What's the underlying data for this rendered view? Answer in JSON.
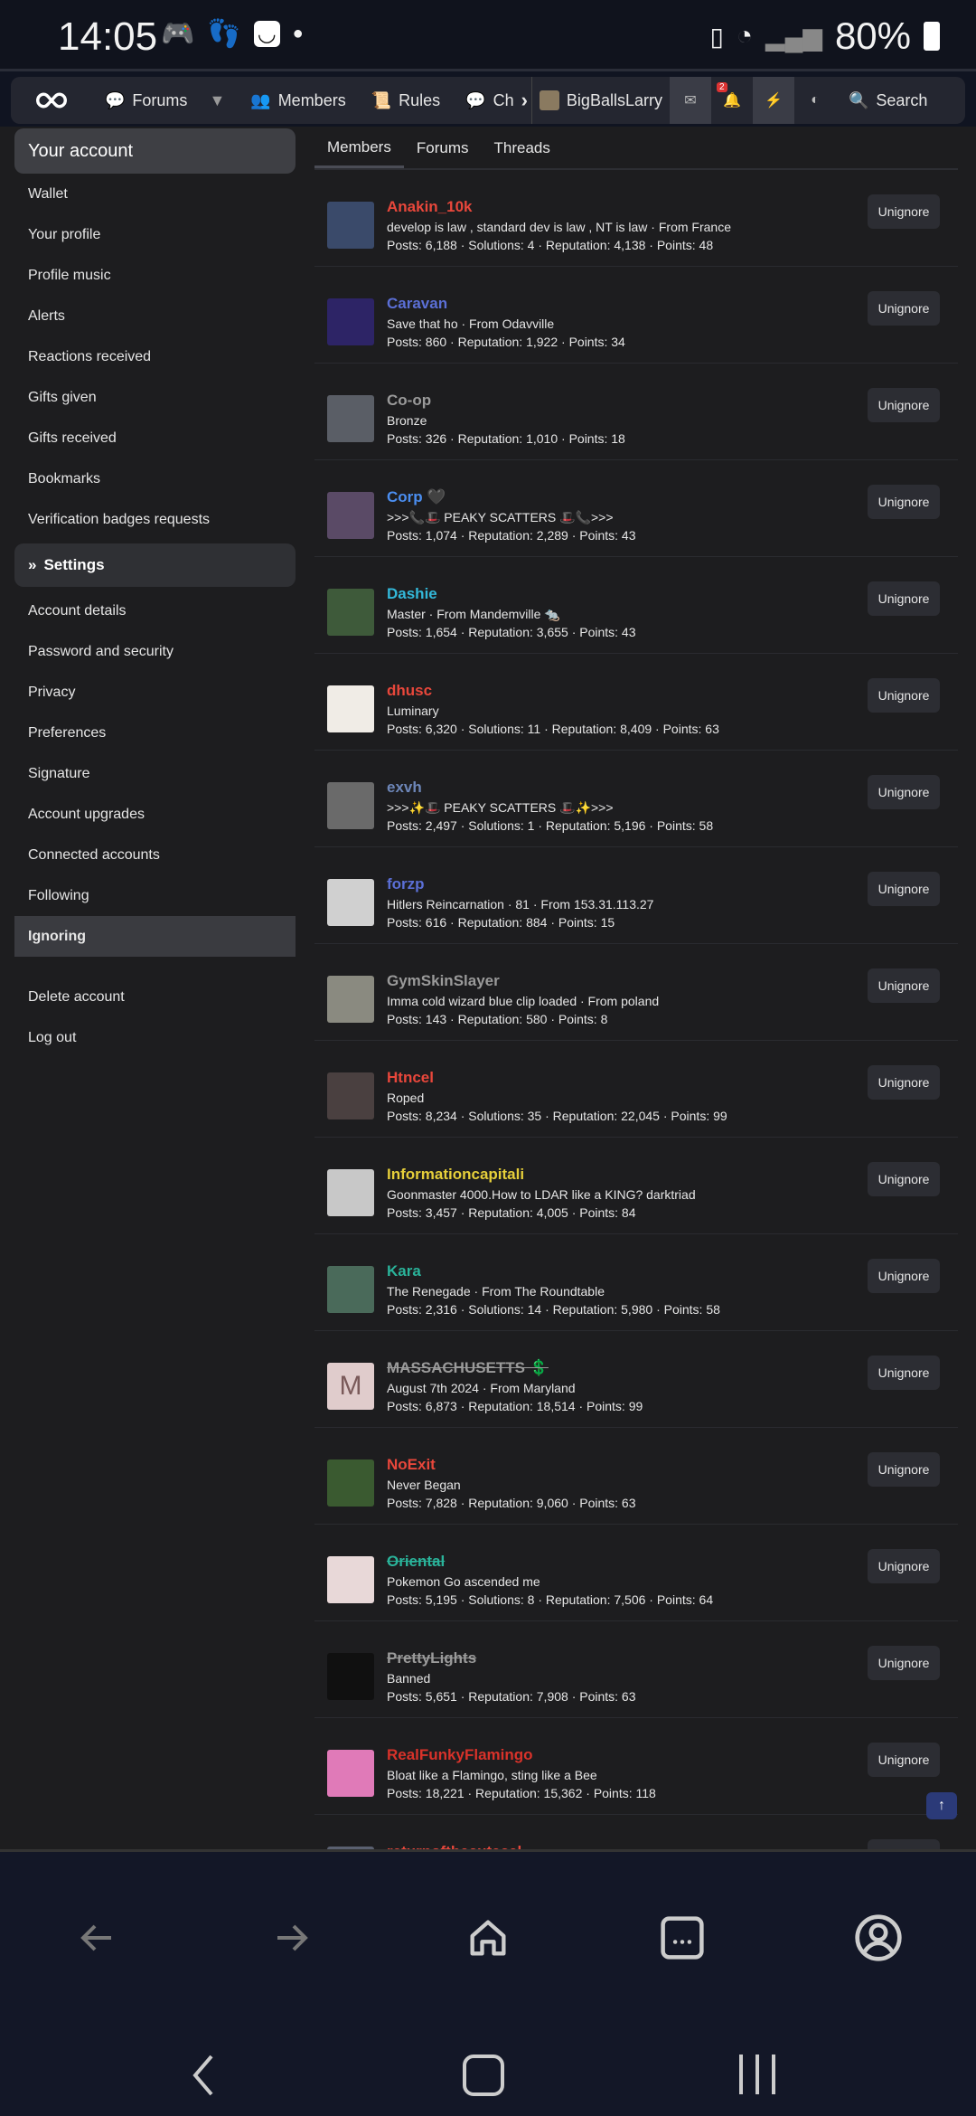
{
  "status": {
    "time": "14:05",
    "battery": "80%"
  },
  "nav": {
    "forums": "Forums",
    "members": "Members",
    "rules": "Rules",
    "chat": "Ch",
    "user": "BigBallsLarry",
    "alerts_badge": "2",
    "search": "Search"
  },
  "sidebar": {
    "account_head": "Your account",
    "account_items": [
      "Wallet",
      "Your profile",
      "Profile music",
      "Alerts",
      "Reactions received",
      "Gifts given",
      "Gifts received",
      "Bookmarks",
      "Verification badges requests"
    ],
    "settings_head": "Settings",
    "settings_items": [
      "Account details",
      "Password and security",
      "Privacy",
      "Preferences",
      "Signature",
      "Account upgrades",
      "Connected accounts",
      "Following",
      "Ignoring"
    ],
    "bottom_items": [
      "Delete account",
      "Log out"
    ]
  },
  "tabs": [
    "Members",
    "Forums",
    "Threads"
  ],
  "unignore_label": "Unignore",
  "members": [
    {
      "name": "Anakin_10k",
      "color": "#e8473b",
      "title": "develop is law , standard dev is law , NT is law · From France",
      "stats": "Posts: 6,188 · Solutions: 4 · Reputation: 4,138 · Points: 48",
      "avatar_color": "#3a4a6a"
    },
    {
      "name": "Caravan",
      "color": "#5b6fd6",
      "title": "Save that ho · From Odavville",
      "stats": "Posts: 860 · Reputation: 1,922 · Points: 34",
      "avatar_color": "#2d2466"
    },
    {
      "name": "Co-op",
      "color": "#9a9a9a",
      "title": "Bronze",
      "stats": "Posts: 326 · Reputation: 1,010 · Points: 18",
      "avatar_color": "#5a5e66"
    },
    {
      "name": "Corp 🖤",
      "color": "#4b8ef0",
      "title": ">>>📞🎩 PEAKY SCATTERS 🎩📞>>>",
      "stats": "Posts: 1,074 · Reputation: 2,289 · Points: 43",
      "avatar_color": "#5a4a66"
    },
    {
      "name": "Dashie",
      "color": "#33b8d9",
      "title": "Master · From Mandemville 🐀",
      "stats": "Posts: 1,654 · Reputation: 3,655 · Points: 43",
      "avatar_color": "#3e5a3a"
    },
    {
      "name": "dhusc",
      "color": "#e8473b",
      "title": "Luminary",
      "stats": "Posts: 6,320 · Solutions: 11 · Reputation: 8,409 · Points: 63",
      "avatar_color": "#f0ece6"
    },
    {
      "name": "exvh",
      "color": "#6d86b8",
      "title": ">>>✨🎩 PEAKY SCATTERS 🎩✨>>>",
      "stats": "Posts: 2,497 · Solutions: 1 · Reputation: 5,196 · Points: 58",
      "avatar_color": "#6a6a6a"
    },
    {
      "name": "forzp",
      "color": "#5b6fd6",
      "title": "Hitlers Reincarnation · 81 · From 153.31.113.27",
      "stats": "Posts: 616 · Reputation: 884 · Points: 15",
      "avatar_color": "#d0d0d0"
    },
    {
      "name": "GymSkinSlayer",
      "color": "#9a9a9a",
      "title": "Imma cold wizard blue clip loaded · From poland",
      "stats": "Posts: 143 · Reputation: 580 · Points: 8",
      "avatar_color": "#8a8a80"
    },
    {
      "name": "Htncel",
      "color": "#e8473b",
      "title": "Roped",
      "stats": "Posts: 8,234 · Solutions: 35 · Reputation: 22,045 · Points: 99",
      "avatar_color": "#4a4040"
    },
    {
      "name": "Informationcapitali",
      "color": "#e6cf3a",
      "title": "Goonmaster 4000.How to LDAR like a KING? darktriad",
      "stats": "Posts: 3,457 · Reputation: 4,005 · Points: 84",
      "avatar_color": "#c8c8c8"
    },
    {
      "name": "Kara",
      "color": "#2ab39a",
      "title": "The Renegade · From The Roundtable",
      "stats": "Posts: 2,316 · Solutions: 14 · Reputation: 5,980 · Points: 58",
      "avatar_color": "#4a6a5a"
    },
    {
      "name": "MASSACHUSETTS 💲",
      "color": "#9a9a9a",
      "strike": true,
      "title": "August 7th 2024 · From Maryland",
      "stats": "Posts: 6,873 · Reputation: 18,514 · Points: 99",
      "avatar_letter": "M"
    },
    {
      "name": "NoExit",
      "color": "#e8473b",
      "title": "Never Began",
      "stats": "Posts: 7,828 · Reputation: 9,060 · Points: 63",
      "avatar_color": "#3a5a30"
    },
    {
      "name": "Oriental",
      "color": "#2ab39a",
      "strike": true,
      "title": "Pokemon Go ascended me",
      "stats": "Posts: 5,195 · Solutions: 8 · Reputation: 7,506 · Points: 64",
      "avatar_color": "#e8d8d8"
    },
    {
      "name": "PrettyLights",
      "color": "#9a9a9a",
      "strike": true,
      "title": "Banned",
      "stats": "Posts: 5,651 · Reputation: 7,908 · Points: 63",
      "avatar_color": "#101010"
    },
    {
      "name": "RealFunkyFlamingo",
      "color": "#d8322a",
      "title": "Bloat like a Flamingo, sting like a Bee",
      "stats": "Posts: 18,221 · Reputation: 15,362 · Points: 118",
      "avatar_color": "#e07ab8"
    },
    {
      "name": "returnofthecutecel",
      "color": "#e8473b",
      "title": "",
      "stats": "",
      "avatar_color": "#5a6070"
    }
  ]
}
